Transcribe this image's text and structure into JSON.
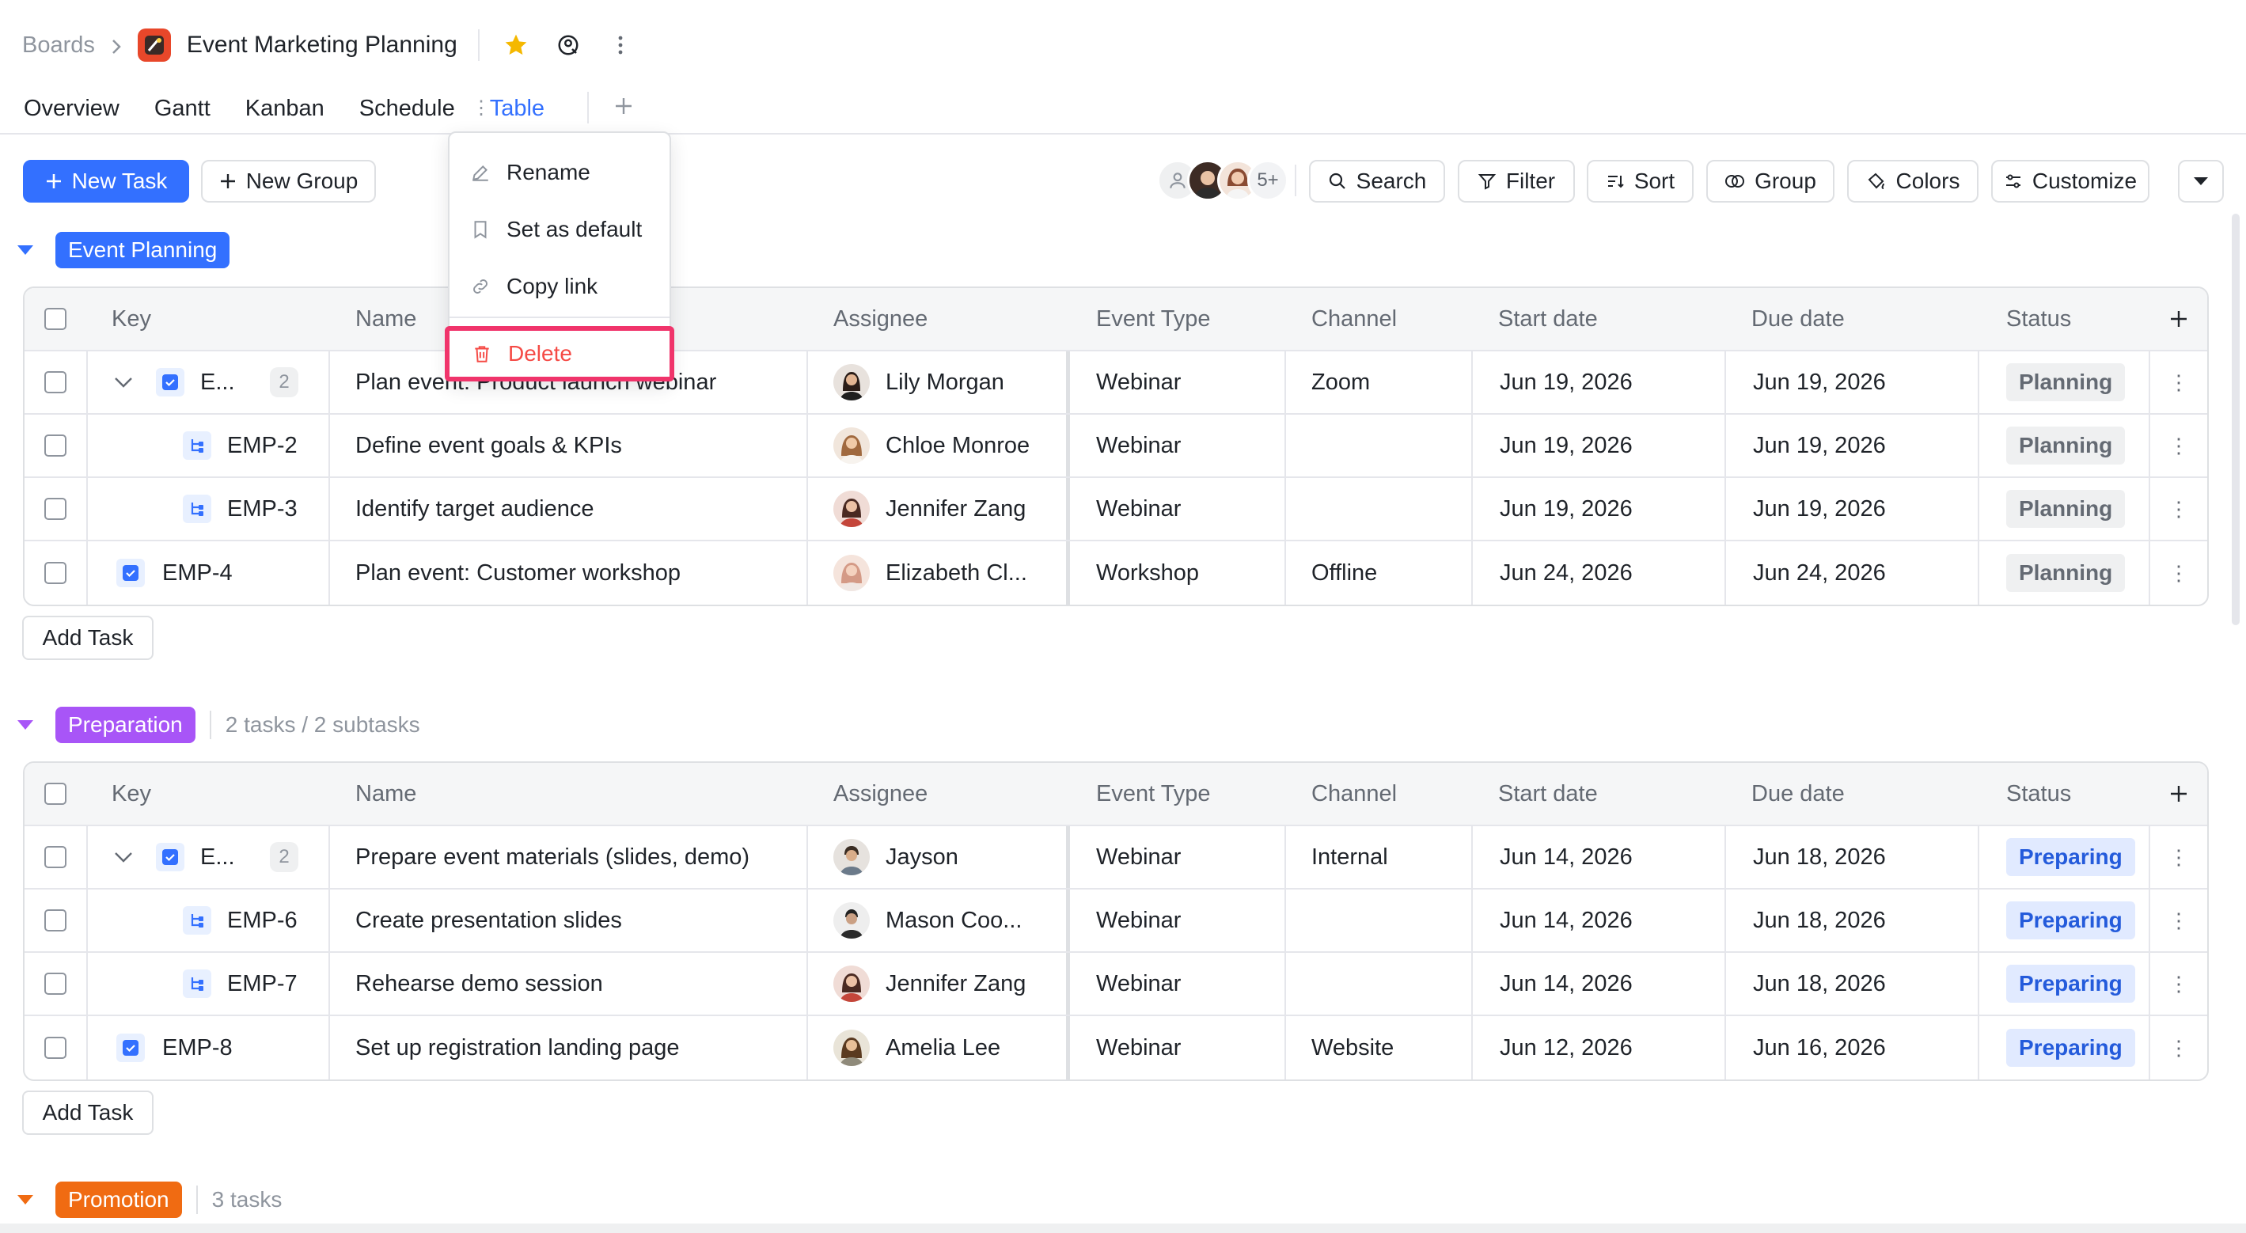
{
  "breadcrumb": {
    "root": "Boards",
    "board_title": "Event Marketing Planning"
  },
  "tabs": [
    "Overview",
    "Gantt",
    "Kanban",
    "Schedule",
    "Table"
  ],
  "active_tab": "Table",
  "toolbar": {
    "new_task": "New Task",
    "new_group": "New Group",
    "members_more": "5+",
    "search": "Search",
    "filter": "Filter",
    "sort": "Sort",
    "group": "Group",
    "colors": "Colors",
    "customize": "Customize"
  },
  "context_menu": {
    "rename": "Rename",
    "set_default": "Set as default",
    "copy_link": "Copy link",
    "delete": "Delete"
  },
  "columns": [
    "Key",
    "Name",
    "Assignee",
    "Event Type",
    "Channel",
    "Start date",
    "Due date",
    "Status"
  ],
  "groups": [
    {
      "name": "Event Planning",
      "color": "#3370ff",
      "count_text": "",
      "add_task": "Add Task",
      "rows": [
        {
          "kind": "parent",
          "key": "E...",
          "sub_count": "2",
          "name": "Plan event: Product launch webinar",
          "assignee": "Lily Morgan",
          "event_type": "Webinar",
          "channel": "Zoom",
          "start": "Jun 19, 2026",
          "due": "Jun 19, 2026",
          "status": "Planning"
        },
        {
          "kind": "sub",
          "key": "EMP-2",
          "name": "Define event goals & KPIs",
          "assignee": "Chloe Monroe",
          "event_type": "Webinar",
          "channel": "",
          "start": "Jun 19, 2026",
          "due": "Jun 19, 2026",
          "status": "Planning"
        },
        {
          "kind": "sub",
          "key": "EMP-3",
          "name": "Identify target audience",
          "assignee": "Jennifer Zang",
          "event_type": "Webinar",
          "channel": "",
          "start": "Jun 19, 2026",
          "due": "Jun 19, 2026",
          "status": "Planning"
        },
        {
          "kind": "task",
          "key": "EMP-4",
          "name": "Plan event: Customer workshop",
          "assignee": "Elizabeth Cl...",
          "event_type": "Workshop",
          "channel": "Offline",
          "start": "Jun 24, 2026",
          "due": "Jun 24, 2026",
          "status": "Planning"
        }
      ]
    },
    {
      "name": "Preparation",
      "color": "#a855f7",
      "count_text": "2 tasks / 2 subtasks",
      "add_task": "Add Task",
      "rows": [
        {
          "kind": "parent",
          "key": "E...",
          "sub_count": "2",
          "name": "Prepare event materials (slides, demo)",
          "assignee": "Jayson",
          "event_type": "Webinar",
          "channel": "Internal",
          "start": "Jun 14, 2026",
          "due": "Jun 18, 2026",
          "status": "Preparing"
        },
        {
          "kind": "sub",
          "key": "EMP-6",
          "name": "Create presentation slides",
          "assignee": "Mason Coo...",
          "event_type": "Webinar",
          "channel": "",
          "start": "Jun 14, 2026",
          "due": "Jun 18, 2026",
          "status": "Preparing"
        },
        {
          "kind": "sub",
          "key": "EMP-7",
          "name": "Rehearse demo session",
          "assignee": "Jennifer Zang",
          "event_type": "Webinar",
          "channel": "",
          "start": "Jun 14, 2026",
          "due": "Jun 18, 2026",
          "status": "Preparing"
        },
        {
          "kind": "task",
          "key": "EMP-8",
          "name": "Set up registration landing page",
          "assignee": "Amelia Lee",
          "event_type": "Webinar",
          "channel": "Website",
          "start": "Jun 12, 2026",
          "due": "Jun 16, 2026",
          "status": "Preparing"
        }
      ]
    },
    {
      "name": "Promotion",
      "color": "#f06b12",
      "count_text": "3 tasks"
    }
  ],
  "colors": {
    "accent": "#3370ff",
    "highlight": "#f0346b",
    "delete": "#f54a45"
  }
}
